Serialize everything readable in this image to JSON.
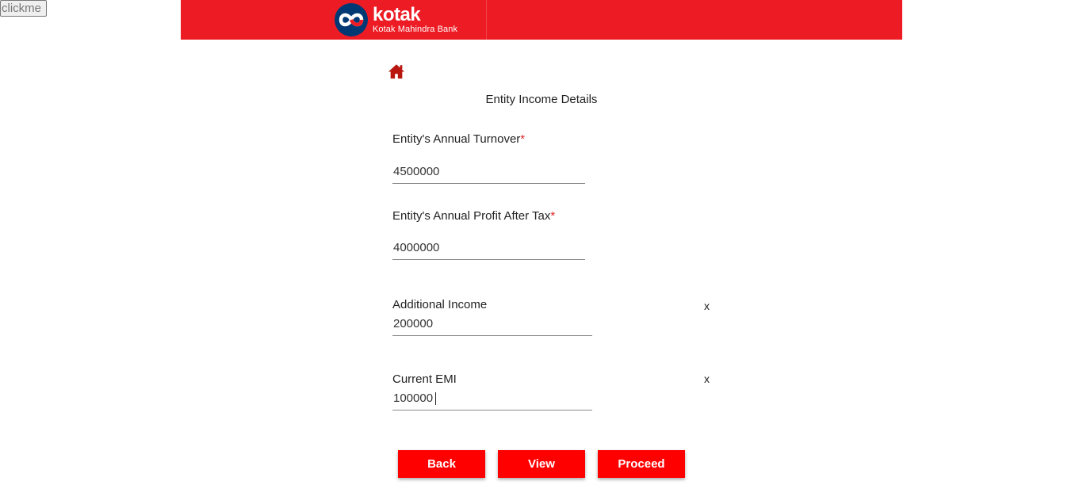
{
  "clickme_label": "clickme",
  "header": {
    "brand_name": "kotak",
    "brand_sub": "Kotak Mahindra Bank",
    "brand_color": "#ed1c24"
  },
  "home_icon": "home-icon",
  "page_title": "Entity Income Details",
  "fields": {
    "turnover": {
      "label": "Entity's Annual Turnover",
      "required_mark": "*",
      "value": "4500000"
    },
    "profit": {
      "label": "Entity's Annual Profit After Tax",
      "required_mark": "*",
      "value": "4000000"
    },
    "additional_income": {
      "label": "Additional Income",
      "value": "200000",
      "remove_label": "x"
    },
    "current_emi": {
      "label": "Current EMI",
      "value": "100000",
      "remove_label": "x"
    }
  },
  "buttons": {
    "back": "Back",
    "view": "View",
    "proceed": "Proceed",
    "color": "#ff0000"
  }
}
